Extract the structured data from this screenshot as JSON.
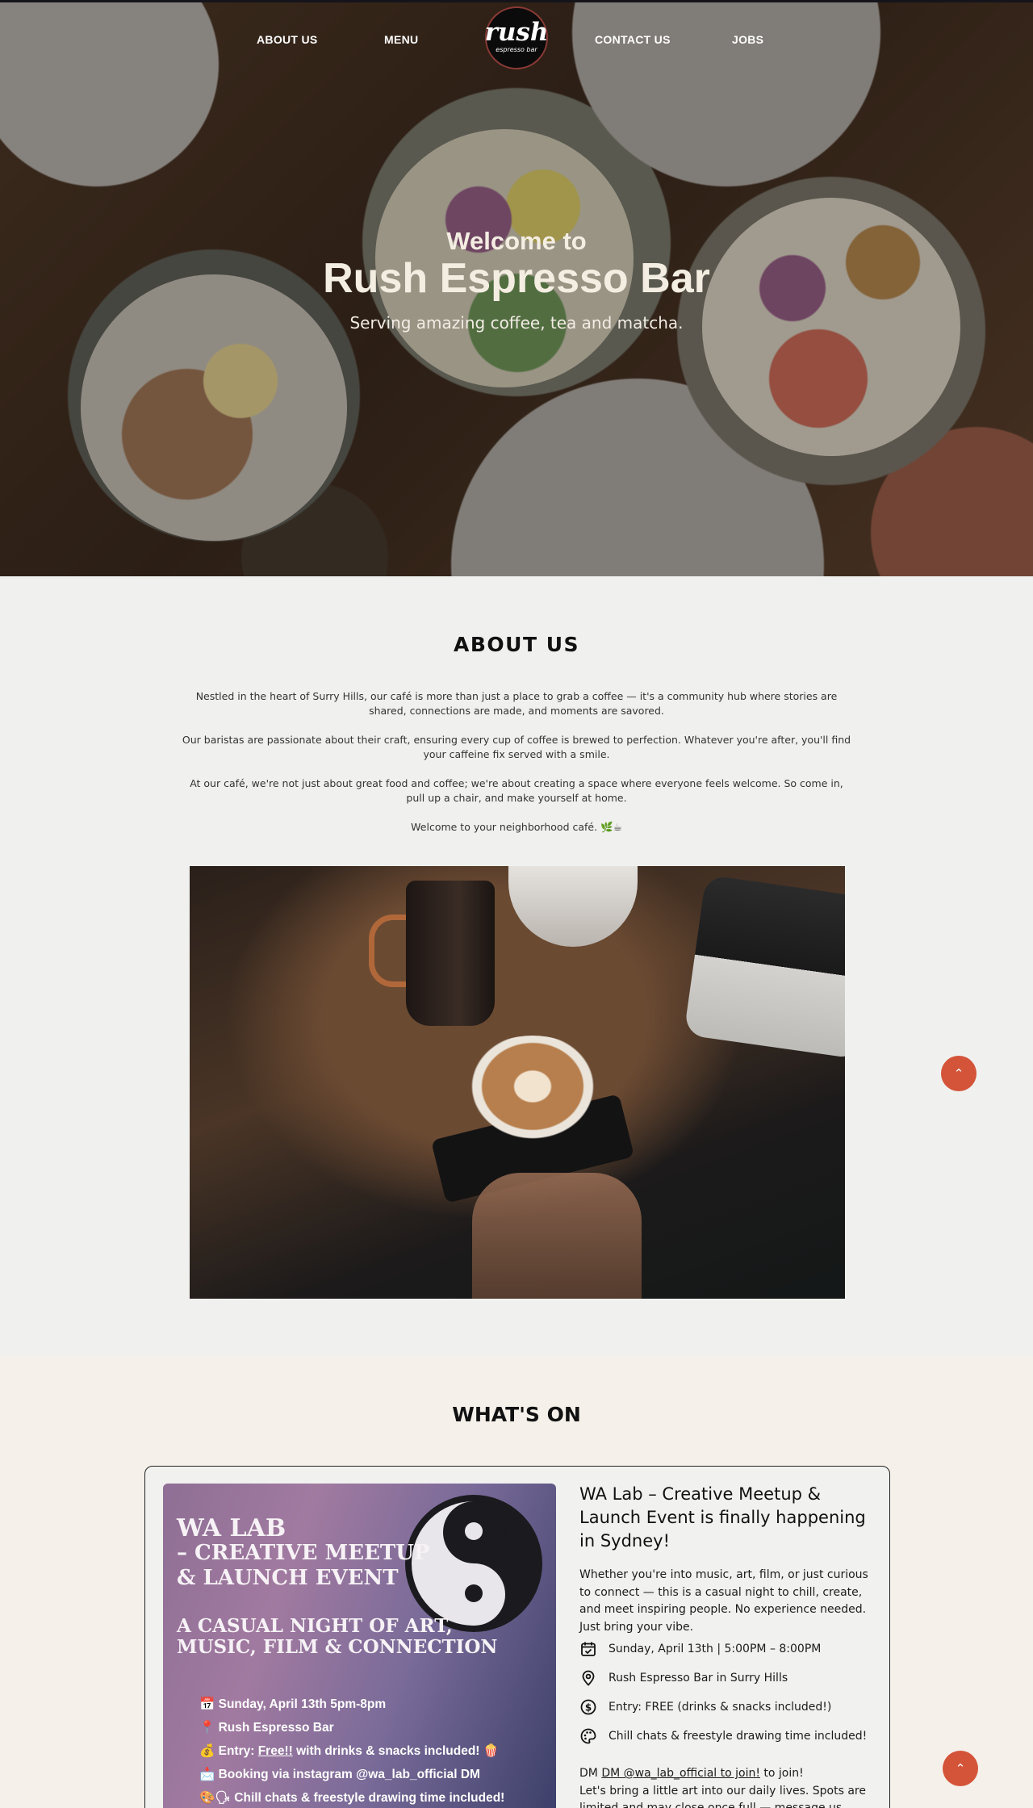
{
  "nav": {
    "about": "ABOUT US",
    "menu": "MENU",
    "contact": "CONTACT US",
    "jobs": "JOBS",
    "logo_main": "rush",
    "logo_sub": "espresso bar"
  },
  "hero": {
    "welcome": "Welcome to",
    "title": "Rush Espresso Bar",
    "subtitle": "Serving amazing coffee, tea and matcha."
  },
  "about": {
    "heading": "ABOUT US",
    "p1": "Nestled in the heart of Surry Hills, our café is more than just a place to grab a coffee — it's a community hub where stories are shared, connections are made, and moments are savored.",
    "p2": "Our baristas are passionate about their craft, ensuring every cup of coffee is brewed to perfection. Whatever you're after, you'll find your caffeine fix served with a smile.",
    "p3": "At our café, we're not just about great food and coffee; we're about creating a space where everyone feels welcome. So come in, pull up a chair, and make yourself at home.",
    "p4": "Welcome to your neighborhood café. 🌿☕"
  },
  "back_to_top": "⌃",
  "whats_on": {
    "heading": "WHAT'S ON",
    "poster": {
      "t1": "WA LAB",
      "t2": "– CREATIVE MEETUP",
      "t3": "& LAUNCH EVENT",
      "t4": "A CASUAL NIGHT OF ART,",
      "t5": "MUSIC, FILM & CONNECTION",
      "l1": "📅 Sunday, April 13th 5pm-8pm",
      "l2": "📍 Rush Espresso Bar",
      "l3_pre": "💰 Entry: ",
      "l3_link": "Free!!",
      "l3_post": " with drinks & snacks included! 🍿",
      "l4": "📩 Booking via instagram @wa_lab_official DM",
      "l5": "🎨🗣 Chill chats & freestyle drawing time included!"
    },
    "event": {
      "title": "WA Lab – Creative Meetup & Launch Event is finally happening in Sydney!",
      "description": "Whether you're into music, art, film, or just curious to connect — this is a casual night to chill, create, and meet inspiring people. No experience needed. Just bring your vibe.",
      "date": "Sunday, April 13th | 5:00PM – 8:00PM",
      "location": "Rush Espresso Bar in Surry Hills",
      "entry": "Entry: FREE (drinks & snacks included!)",
      "activity": "Chill chats & freestyle drawing time included!",
      "dm_pre": "DM ",
      "dm_link": "DM @wa_lab_official to join!",
      "dm_post": " to join!",
      "closing": "Let's bring a little art into our daily lives. Spots are limited and may close once full — message us"
    }
  },
  "colors": {
    "accent": "#d4543a",
    "background": "#f0f1ee",
    "whats_on_bg": "#f5f1ea"
  }
}
